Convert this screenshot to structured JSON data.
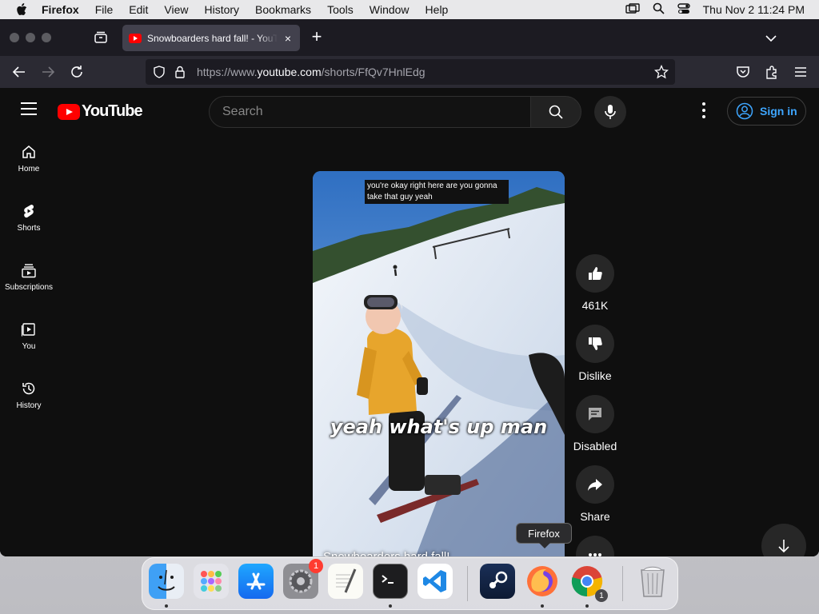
{
  "menubar": {
    "app_name": "Firefox",
    "menus": [
      "File",
      "Edit",
      "View",
      "History",
      "Bookmarks",
      "Tools",
      "Window",
      "Help"
    ],
    "clock": "Thu Nov 2  11:24 PM"
  },
  "browser": {
    "tab_title": "Snowboarders hard fall! - YouTube",
    "url_prefix": "https://www.",
    "url_domain": "youtube.com",
    "url_path": "/shorts/FfQv7HnlEdg"
  },
  "youtube": {
    "logo_text": "YouTube",
    "search_placeholder": "Search",
    "sign_in": "Sign in",
    "sidebar": [
      {
        "label": "Home",
        "icon": "home-icon"
      },
      {
        "label": "Shorts",
        "icon": "shorts-icon"
      },
      {
        "label": "Subscriptions",
        "icon": "subscriptions-icon"
      },
      {
        "label": "You",
        "icon": "you-icon"
      },
      {
        "label": "History",
        "icon": "history-icon"
      }
    ],
    "short": {
      "caption_top": "you're okay right here are you gonna take that guy yeah",
      "caption_big": "yeah what's up man",
      "title": "Snowboarders hard fall!"
    },
    "actions": {
      "like_count": "461K",
      "dislike": "Dislike",
      "comments": "Disabled",
      "share": "Share"
    }
  },
  "dock": {
    "tooltip": "Firefox",
    "settings_badge": "1",
    "chrome_badge": "1"
  }
}
